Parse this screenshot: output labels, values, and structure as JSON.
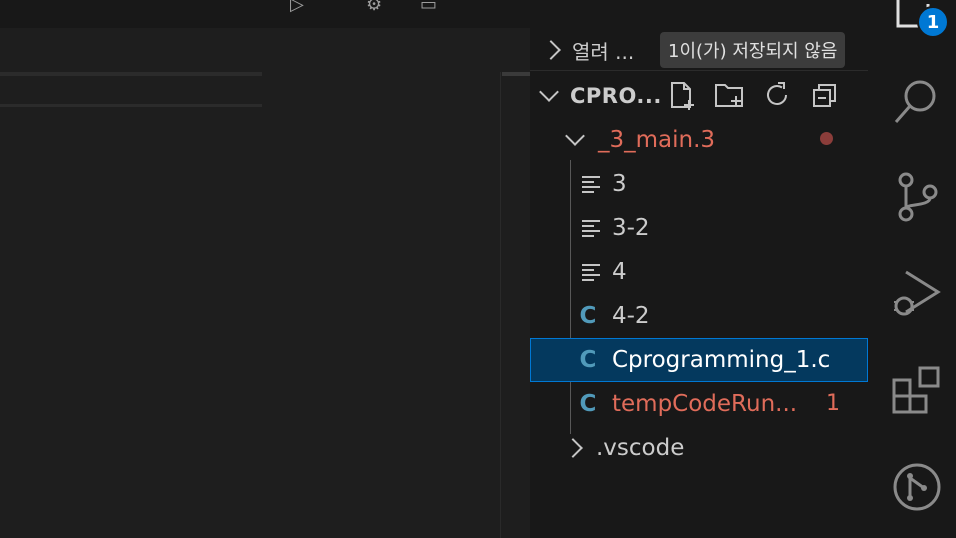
{
  "explorer": {
    "open_editors_label": "열려 ...",
    "project_label": "CPRO...",
    "tooltip": "1이(가) 저장되지 않음",
    "actions": [
      "new-file-icon",
      "new-folder-icon",
      "refresh-icon",
      "collapse-all-icon"
    ]
  },
  "tree": {
    "folder": "_3_main.3",
    "files": [
      {
        "name": "3",
        "icon": "text-file-icon"
      },
      {
        "name": "3-2",
        "icon": "text-file-icon"
      },
      {
        "name": "4",
        "icon": "text-file-icon"
      },
      {
        "name": "4-2",
        "icon": "c-file-icon"
      },
      {
        "name": "Cprogramming_1.c",
        "icon": "c-file-icon"
      },
      {
        "name": "tempCodeRun...",
        "icon": "c-file-icon",
        "problems": "1"
      }
    ],
    "subfolder": ".vscode"
  },
  "activity_bar": {
    "explorer_badge": "1",
    "items": [
      "explorer-icon",
      "search-icon",
      "source-control-icon",
      "run-debug-icon",
      "extensions-icon",
      "git-graph-icon"
    ]
  },
  "colors": {
    "accent": "#0078d4",
    "selection": "#04395e",
    "modified": "#e06c5a",
    "c_icon": "#519aba"
  }
}
